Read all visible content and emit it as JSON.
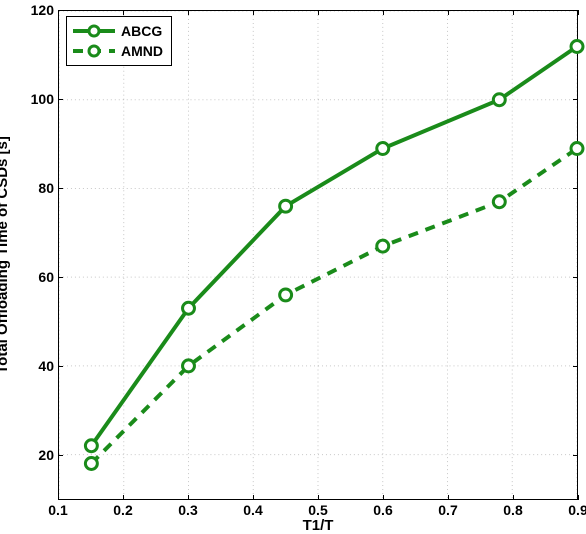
{
  "chart_data": {
    "type": "line",
    "title": "",
    "xlabel": "T1/T",
    "ylabel": "Total Offloading Time of CSDs [s]",
    "xlim": [
      0.1,
      0.9
    ],
    "ylim": [
      10,
      120
    ],
    "xticks": [
      0.1,
      0.2,
      0.3,
      0.4,
      0.5,
      0.6,
      0.7,
      0.8,
      0.9
    ],
    "yticks": [
      20,
      40,
      60,
      80,
      100,
      120
    ],
    "x": [
      0.15,
      0.3,
      0.45,
      0.6,
      0.78,
      0.9
    ],
    "series": [
      {
        "name": "ABCG",
        "style": "solid",
        "values": [
          22,
          53,
          76,
          89,
          100,
          112
        ]
      },
      {
        "name": "AMND",
        "style": "dashed",
        "values": [
          18,
          40,
          56,
          67,
          77,
          89
        ]
      }
    ],
    "legend_position": "top-left",
    "grid": true,
    "color": "#1a8b1a"
  }
}
